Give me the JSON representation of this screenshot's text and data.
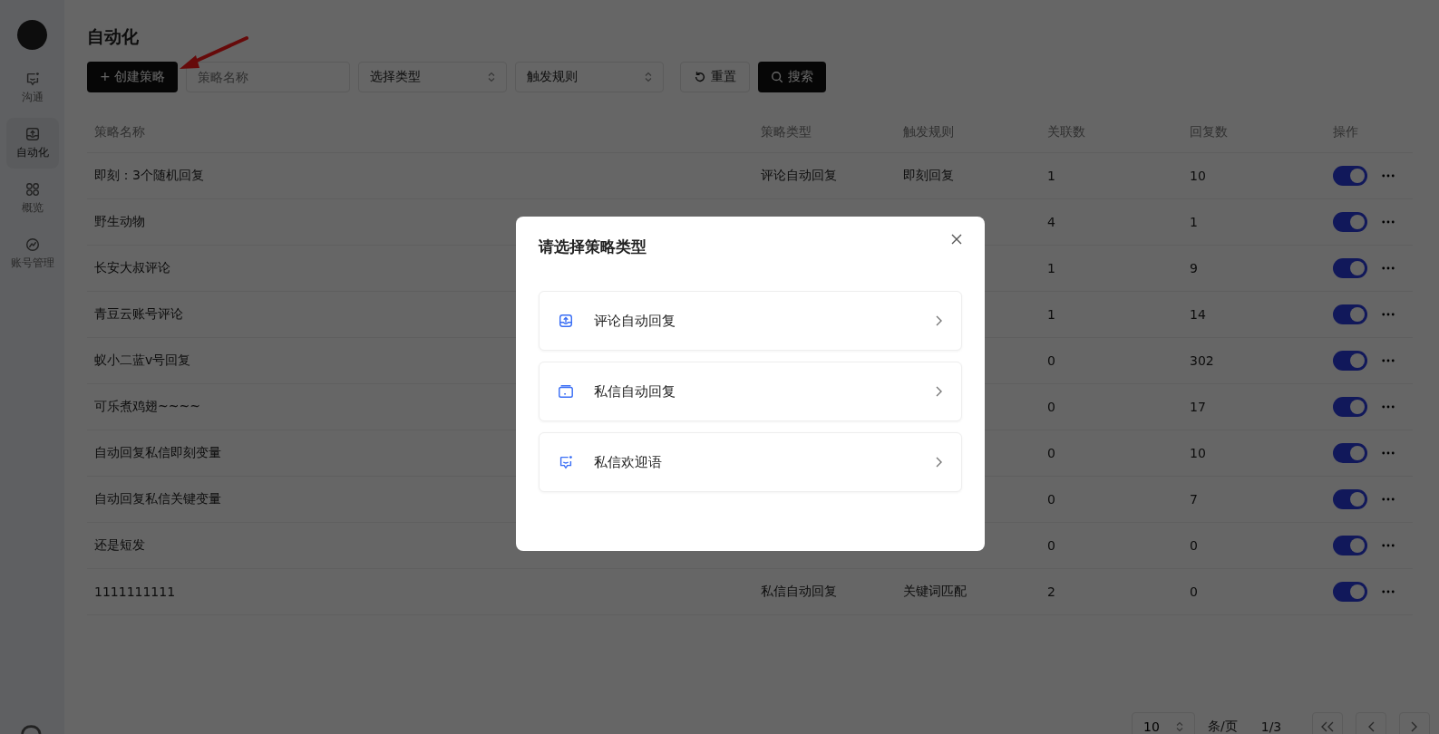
{
  "sidebar": {
    "items": [
      {
        "label": "沟通",
        "selected": false
      },
      {
        "label": "自动化",
        "selected": true
      },
      {
        "label": "概览",
        "selected": false
      },
      {
        "label": "账号管理",
        "selected": false
      }
    ]
  },
  "page": {
    "title": "自动化"
  },
  "toolbar": {
    "create_button": "+ 创建策略",
    "name_field": {
      "placeholder": "策略名称"
    },
    "type_select": {
      "value": "选择类型"
    },
    "rule_select": {
      "value": "触发规则"
    },
    "reset_button": "重置",
    "search_button": "搜索"
  },
  "table": {
    "columns": [
      "策略名称",
      "策略类型",
      "触发规则",
      "关联数",
      "回复数",
      "操作"
    ],
    "rows": [
      {
        "name": "即刻：3个随机回复",
        "type": "评论自动回复",
        "rule": "即刻回复",
        "links": "1",
        "replies": "10",
        "enabled": true
      },
      {
        "name": "野生动物",
        "links": "4",
        "replies": "1",
        "enabled": true
      },
      {
        "name": "长安大叔评论",
        "links": "1",
        "replies": "9",
        "enabled": true
      },
      {
        "name": "青豆云账号评论",
        "links": "1",
        "replies": "14",
        "enabled": true
      },
      {
        "name": "蚁小二蓝v号回复",
        "links": "0",
        "replies": "302",
        "enabled": true
      },
      {
        "name": "可乐煮鸡翅~~~~",
        "links": "0",
        "replies": "17",
        "enabled": true
      },
      {
        "name": "自动回复私信即刻变量",
        "links": "0",
        "replies": "10",
        "enabled": true
      },
      {
        "name": "自动回复私信关键变量",
        "links": "0",
        "replies": "7",
        "enabled": true
      },
      {
        "name": "还是短发",
        "links": "0",
        "replies": "0",
        "enabled": true
      },
      {
        "name": "1111111111",
        "type": "私信自动回复",
        "rule": "关键词匹配",
        "links": "2",
        "replies": "0",
        "enabled": true
      }
    ]
  },
  "pagination": {
    "page_size": "10",
    "unit": "条/页",
    "page": "1/3"
  },
  "dialog": {
    "title": "请选择策略类型",
    "options": [
      {
        "label": "评论自动回复"
      },
      {
        "label": "私信自动回复"
      },
      {
        "label": "私信欢迎语"
      }
    ]
  }
}
